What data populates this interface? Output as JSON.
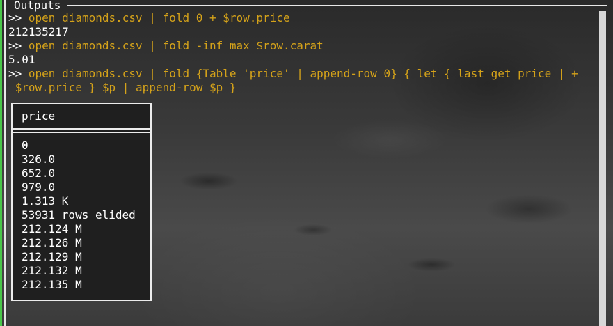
{
  "panel": {
    "title": "Outputs"
  },
  "console": {
    "prompt": ">>",
    "lines": [
      {
        "cmd": "open diamonds.csv | fold 0 + $row.price"
      },
      {
        "out": "212135217"
      },
      {
        "cmd": "open diamonds.csv | fold -inf max $row.carat"
      },
      {
        "out": "5.01"
      },
      {
        "cmd": "open diamonds.csv | fold {Table 'price' | append-row 0} { let { last get price | +"
      },
      {
        "cont": " $row.price } $p | append-row $p }"
      }
    ]
  },
  "table": {
    "header": "price",
    "rows": [
      "0",
      "326.0",
      "652.0",
      "979.0",
      "1.313 K",
      "53931 rows elided",
      "212.124 M",
      "212.126 M",
      "212.129 M",
      "212.132 M",
      "212.135 M"
    ]
  }
}
